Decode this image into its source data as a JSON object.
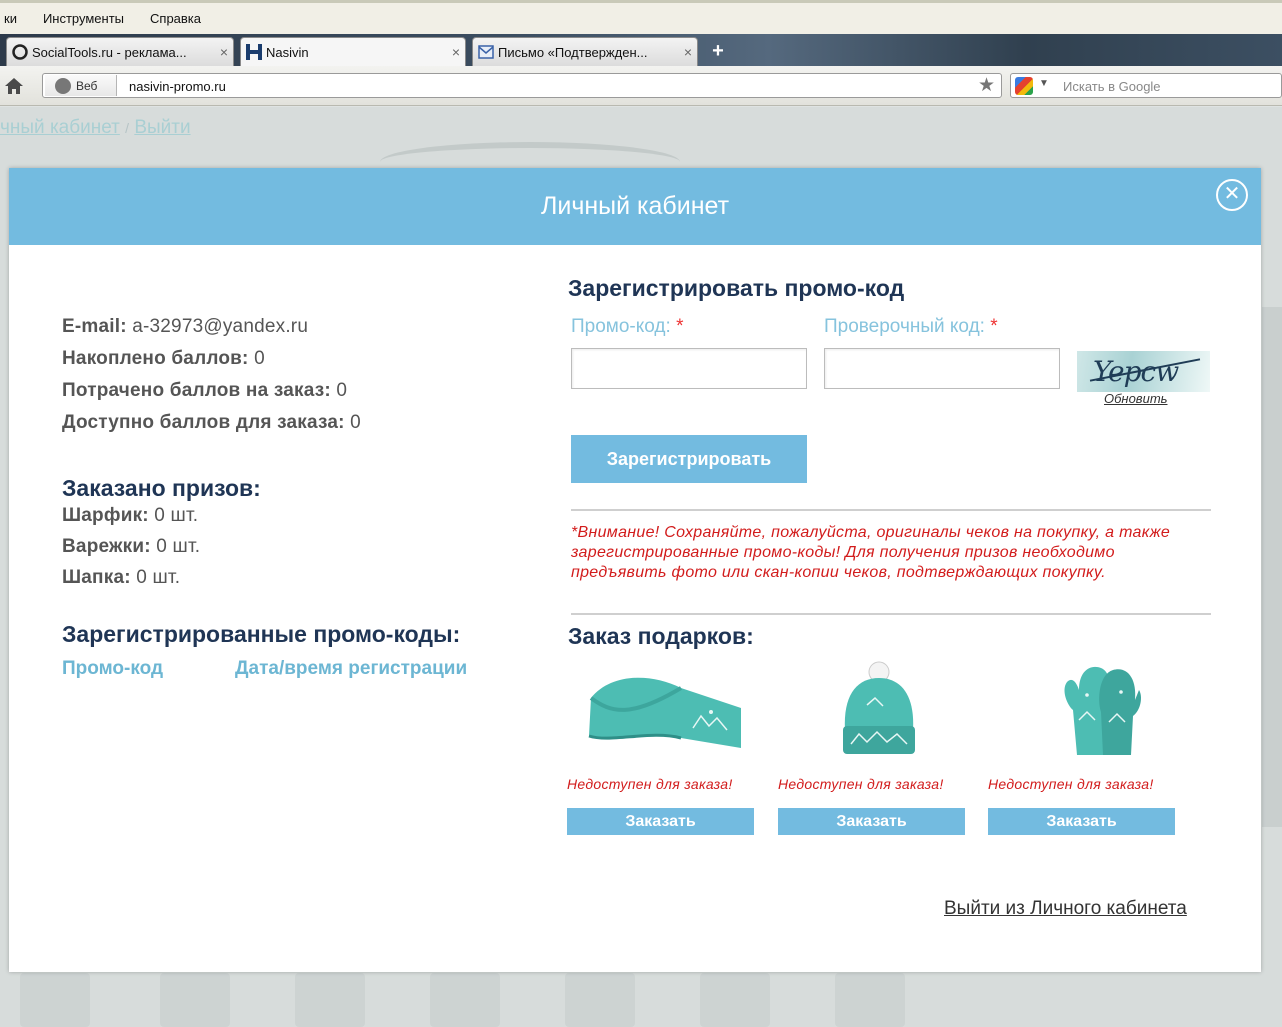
{
  "browser": {
    "menu": [
      "ки",
      "Инструменты",
      "Справка"
    ],
    "tabs": [
      {
        "title": "SocialTools.ru - реклама...",
        "close": "×"
      },
      {
        "title": "Nasivin",
        "close": "×"
      },
      {
        "title": "Письмо «Подтвержден...",
        "close": "×"
      }
    ],
    "newtab": "+",
    "url_badge": "Веб",
    "url": "nasivin-promo.ru",
    "search_placeholder": "Искать в Google"
  },
  "page": {
    "link_cabinet": "чный кабинет",
    "link_sep": "/",
    "link_logout": "Выйти"
  },
  "modal": {
    "title": "Личный кабинет",
    "close_icon": "close-circle-icon",
    "account": {
      "email_label": "E-mail:",
      "email_value": "a-32973@yandex.ru",
      "accumulated_label": "Накоплено баллов:",
      "accumulated_value": "0",
      "spent_label": "Потрачено баллов на заказ:",
      "spent_value": "0",
      "available_label": "Доступно баллов для заказа:",
      "available_value": "0"
    },
    "ordered": {
      "title": "Заказано призов:",
      "items": [
        {
          "label": "Шарфик:",
          "value": "0 шт."
        },
        {
          "label": "Варежки:",
          "value": "0 шт."
        },
        {
          "label": "Шапка:",
          "value": "0 шт."
        }
      ]
    },
    "registered": {
      "title": "Зарегистрированные промо-коды:",
      "col_code": "Промо-код",
      "col_date": "Дата/время регистрации"
    },
    "register": {
      "title": "Зарегистрировать промо-код",
      "promo_label": "Промо-код:",
      "check_label": "Проверочный код:",
      "required_mark": "*",
      "captcha_text": "Yepcw",
      "refresh": "Обновить",
      "button": "Зарегистрировать"
    },
    "warning": "*Внимание! Сохраняйте, пожалуйста, оригиналы чеков на покупку, а также зарегистрированные промо-коды! Для получения призов необходимо предъявить фото или скан-копии чеков, подтверждающих покупку.",
    "gifts": {
      "title": "Заказ подарков:",
      "items": [
        {
          "name": "scarf",
          "status": "Недоступен для заказа!",
          "button": "Заказать"
        },
        {
          "name": "hat",
          "status": "Недоступен для заказа!",
          "button": "Заказать"
        },
        {
          "name": "mittens",
          "status": "Недоступен для заказа!",
          "button": "Заказать"
        }
      ]
    },
    "logout": "Выйти из Личного кабинета"
  },
  "colors": {
    "accent": "#73bbe0",
    "heading": "#1f3555",
    "warning": "#d21c1c",
    "label": "#86c3dd"
  }
}
